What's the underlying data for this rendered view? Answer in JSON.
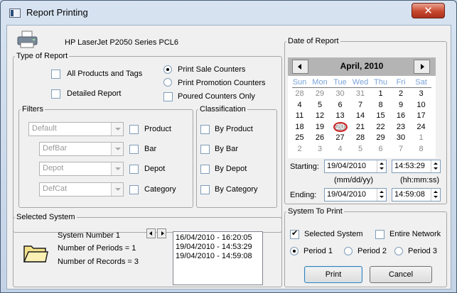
{
  "window": {
    "title": "Report Printing",
    "close_glyph": "✕"
  },
  "printer": {
    "name": "HP LaserJet P2050 Series PCL6",
    "icon": "printer-icon"
  },
  "type_of_report": {
    "legend": "Type of Report",
    "all_products": "All Products and Tags",
    "detailed": "Detailed Report",
    "print_sale": "Print Sale Counters",
    "print_promotion": "Print Promotion Counters",
    "poured_only": "Poured Counters Only"
  },
  "filters": {
    "legend": "Filters",
    "rows": [
      {
        "combo": "Default",
        "label": "Product"
      },
      {
        "combo": "DefBar",
        "label": "Bar"
      },
      {
        "combo": "Depot",
        "label": "Depot"
      },
      {
        "combo": "DefCat",
        "label": "Category"
      }
    ]
  },
  "classification": {
    "legend": "Classification",
    "items": [
      "By Product",
      "By Bar",
      "By Depot",
      "By Category"
    ]
  },
  "selected_system": {
    "legend": "Selected System",
    "system_number": "System Number 1",
    "periods": "Number of Periods = 1",
    "records": "Number of Records = 3",
    "list": [
      "16/04/2010 - 16:20:05",
      "19/04/2010 - 14:53:29",
      "19/04/2010 - 14:59:08"
    ]
  },
  "date_of_report": {
    "legend": "Date of Report",
    "month": "April, 2010",
    "days_of_week": [
      "Sun",
      "Mon",
      "Tue",
      "Wed",
      "Thu",
      "Fri",
      "Sat"
    ],
    "weeks": [
      [
        "28",
        "29",
        "30",
        "31",
        "1",
        "2",
        "3"
      ],
      [
        "4",
        "5",
        "6",
        "7",
        "8",
        "9",
        "10"
      ],
      [
        "11",
        "12",
        "13",
        "14",
        "15",
        "16",
        "17"
      ],
      [
        "18",
        "19",
        "20",
        "21",
        "22",
        "23",
        "24"
      ],
      [
        "25",
        "26",
        "27",
        "28",
        "29",
        "30",
        "1"
      ],
      [
        "2",
        "3",
        "4",
        "5",
        "6",
        "7",
        "8"
      ]
    ],
    "selected_day": "20",
    "starting_label": "Starting:",
    "starting_date": "19/04/2010",
    "starting_time": "14:53:29",
    "date_format": "(mm/dd/yy)",
    "time_format": "(hh:mm:ss)",
    "ending_label": "Ending:",
    "ending_date": "19/04/2010",
    "ending_time": "14:59:08"
  },
  "system_to_print": {
    "legend": "System To Print",
    "selected_system": "Selected System",
    "entire_network": "Entire Network",
    "periods": [
      "Period 1",
      "Period 2",
      "Period 3"
    ]
  },
  "buttons": {
    "print": "Print",
    "cancel": "Cancel"
  }
}
